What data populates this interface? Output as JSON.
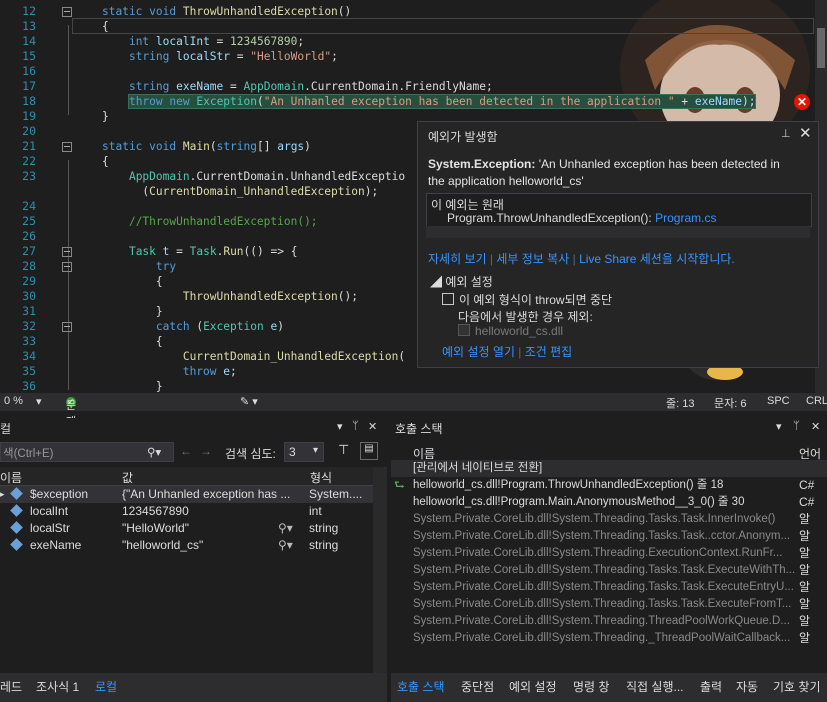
{
  "editor": {
    "lines": [
      {
        "n": "12",
        "html": "<span class=\"kw\">static</span> <span class=\"kw\">void</span> <span class=\"fn\">ThrowUnhandledException</span>()"
      },
      {
        "n": "13",
        "html": "{"
      },
      {
        "n": "14",
        "html": "    <span class=\"kw\">int</span> <span class=\"id\">localInt</span> = <span class=\"num\">1234567890</span>;"
      },
      {
        "n": "15",
        "html": "    <span class=\"kw\">string</span> <span class=\"id\">localStr</span> = <span class=\"str\">\"HelloWorld\"</span>;"
      },
      {
        "n": "16",
        "html": ""
      },
      {
        "n": "17",
        "html": "    <span class=\"kw\">string</span> <span class=\"id\">exeName</span> = <span class=\"ty\">AppDomain</span>.CurrentDomain.FriendlyName;"
      },
      {
        "n": "18",
        "html": "    <span class=\"hl\"><span class=\"kw\">throw</span> <span class=\"kw\">new</span> <span class=\"ty\">Exception</span>(<span class=\"str\">\"An Unhanled exception has been detected in the application \"</span> + <span class=\"id\">exeName</span>);</span>"
      },
      {
        "n": "19",
        "html": "}"
      },
      {
        "n": "20",
        "html": ""
      },
      {
        "n": "21",
        "html": "<span class=\"kw\">static</span> <span class=\"kw\">void</span> <span class=\"fn\">Main</span>(<span class=\"kw\">string</span>[] <span class=\"id\">args</span>)"
      },
      {
        "n": "22",
        "html": "{"
      },
      {
        "n": "23",
        "html": "    <span class=\"ty\">AppDomain</span>.CurrentDomain.UnhandledExceptio"
      },
      {
        "n": "",
        "html": "      (<span class=\"fn\">CurrentDomain_UnhandledException</span>);"
      },
      {
        "n": "24",
        "html": ""
      },
      {
        "n": "25",
        "html": "    <span class=\"cm\">//ThrowUnhandledException();</span>"
      },
      {
        "n": "26",
        "html": ""
      },
      {
        "n": "27",
        "html": "    <span class=\"ty\">Task</span> <span class=\"id\">t</span> = <span class=\"ty\">Task</span>.<span class=\"fn\">Run</span>(() => {"
      },
      {
        "n": "28",
        "html": "        <span class=\"kw\">try</span>"
      },
      {
        "n": "29",
        "html": "        {"
      },
      {
        "n": "30",
        "html": "            <span class=\"fn\">ThrowUnhandledException</span>();"
      },
      {
        "n": "31",
        "html": "        }"
      },
      {
        "n": "32",
        "html": "        <span class=\"kw\">catch</span> (<span class=\"ty\">Exception</span> <span class=\"id\">e</span>)"
      },
      {
        "n": "33",
        "html": "        {"
      },
      {
        "n": "34",
        "html": "            <span class=\"fn\">CurrentDomain_UnhandledException</span>("
      },
      {
        "n": "35",
        "html": "            <span class=\"kw\">throw</span> <span class=\"id\">e</span>;"
      },
      {
        "n": "36",
        "html": "        }"
      }
    ]
  },
  "exception": {
    "title": "예외가 발생함",
    "pin": "ᵖ",
    "close": "✕",
    "type": "System.Exception:",
    "message": " 'An Unhanled exception has been detected in the application helloworld_cs'",
    "inner_title": "이 예외는 원래",
    "inner_text": "Program.ThrowUnhandledException(): ",
    "inner_link": "Program.cs",
    "link_details": "자세히 보기",
    "link_copy": "세부 정보 복사",
    "link_liveshare": "Live Share 세션을 시작합니다.",
    "settings_title": "◢ 예외 설정",
    "break_option": "이 예외 형식이 throw되면 중단",
    "except_label": "다음에서 발생한 경우 제외:",
    "except_module": "helloworld_cs.dll",
    "link_open_settings": "예외 설정 열기",
    "link_edit_conditions": "조건 편집"
  },
  "editor_status": {
    "zoom": "0 %",
    "issues": "문제가 검색되지 않음",
    "line": "줄: 13",
    "col": "문자: 6",
    "spc": "SPC",
    "crlf": "CRLF"
  },
  "locals": {
    "title": "컬",
    "search_placeholder": "색(Ctrl+E)",
    "search_depth_label": "검색 심도:",
    "search_depth_value": "3",
    "columns": [
      "이름",
      "값",
      "형식"
    ],
    "rows": [
      {
        "name": "$exception",
        "value": "{\"An Unhanled exception has ...",
        "type": "System...."
      },
      {
        "name": "localInt",
        "value": "1234567890",
        "type": "int"
      },
      {
        "name": "localStr",
        "value": "\"HelloWorld\"",
        "type": "string"
      },
      {
        "name": "exeName",
        "value": "\"helloworld_cs\"",
        "type": "string"
      }
    ]
  },
  "callstack": {
    "title": "호출 스택",
    "columns": [
      "이름",
      "언어"
    ],
    "rows": [
      {
        "name": "[관리에서 네이티브로 전환]",
        "lang": "",
        "dim": false
      },
      {
        "name": "helloworld_cs.dll!Program.ThrowUnhandledException() 줄 18",
        "lang": "C#",
        "dim": false,
        "current": true
      },
      {
        "name": "helloworld_cs.dll!Program.Main.AnonymousMethod__3_0() 줄 30",
        "lang": "C#",
        "dim": false
      },
      {
        "name": "System.Private.CoreLib.dll!System.Threading.Tasks.Task.InnerInvoke()",
        "lang": "알",
        "dim": true
      },
      {
        "name": "System.Private.CoreLib.dll!System.Threading.Tasks.Task..cctor.Anonym...",
        "lang": "알",
        "dim": true
      },
      {
        "name": "System.Private.CoreLib.dll!System.Threading.ExecutionContext.RunFr...",
        "lang": "알",
        "dim": true
      },
      {
        "name": "System.Private.CoreLib.dll!System.Threading.Tasks.Task.ExecuteWithTh...",
        "lang": "알",
        "dim": true
      },
      {
        "name": "System.Private.CoreLib.dll!System.Threading.Tasks.Task.ExecuteEntryU...",
        "lang": "알",
        "dim": true
      },
      {
        "name": "System.Private.CoreLib.dll!System.Threading.Tasks.Task.ExecuteFromT...",
        "lang": "알",
        "dim": true
      },
      {
        "name": "System.Private.CoreLib.dll!System.Threading.ThreadPoolWorkQueue.D...",
        "lang": "알",
        "dim": true
      },
      {
        "name": "System.Private.CoreLib.dll!System.Threading._ThreadPoolWaitCallback...",
        "lang": "알",
        "dim": true
      }
    ]
  },
  "left_tabs": [
    "레드",
    "조사식 1",
    "로컬"
  ],
  "right_tabs": [
    "호출 스택",
    "중단점",
    "예외 설정",
    "명령 창",
    "직접 실행...",
    "출력",
    "자동",
    "기호 찾기"
  ]
}
